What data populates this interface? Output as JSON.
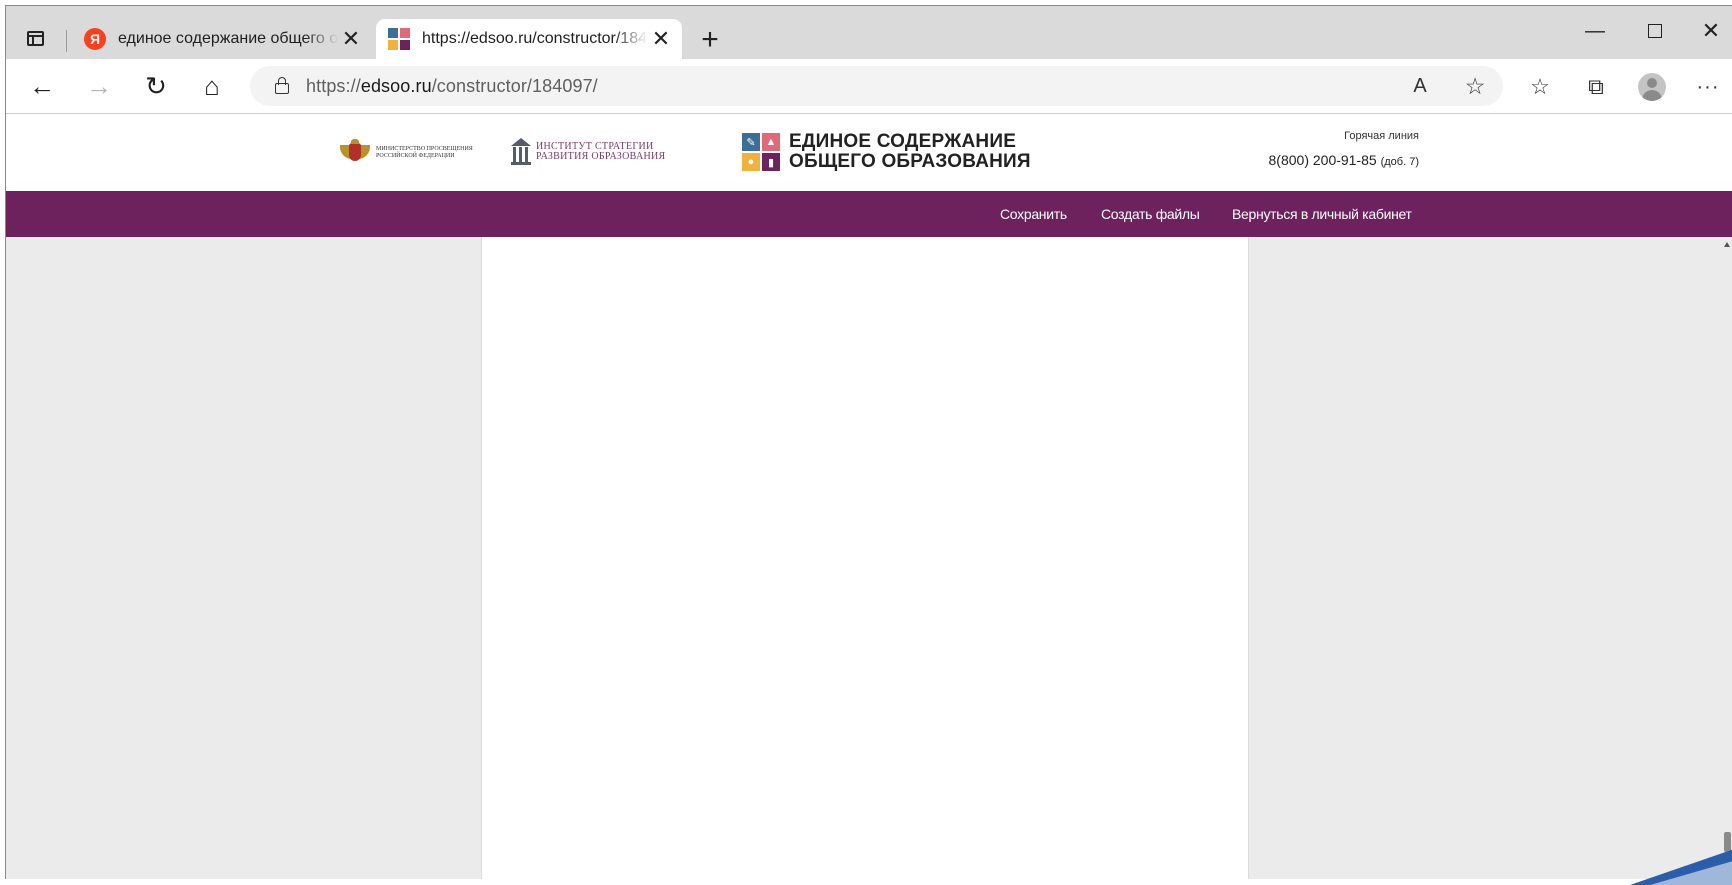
{
  "browser": {
    "tabs": [
      {
        "title": "единое содержание общего об",
        "close": "✕",
        "favicon": "Я",
        "active": false
      },
      {
        "title": "https://edsoo.ru/constructor/184",
        "close": "✕",
        "active": true
      }
    ],
    "new_tab": "+",
    "window_controls": {
      "minimize": "—",
      "close": "✕"
    },
    "address": {
      "scheme": "https://",
      "host": "edsoo.ru",
      "path": "/constructor/184097/"
    },
    "icons": {
      "back": "←",
      "forward": "→",
      "reload": "↻",
      "home": "⌂",
      "read_aloud": "A",
      "add_favorite": "☆",
      "favorites": "☆",
      "collections": "⧉",
      "more": "···"
    }
  },
  "site": {
    "header": {
      "ministry_text": "МИНИСТЕРСТВО ПРОСВЕЩЕНИЯ РОССИЙСКОЙ ФЕДЕРАЦИИ",
      "institute_line1": "ИНСТИТУТ СТРАТЕГИИ",
      "institute_line2": "РАЗВИТИЯ ОБРАЗОВАНИЯ",
      "brand_line1": "ЕДИНОЕ СОДЕРЖАНИЕ",
      "brand_line2": "ОБЩЕГО ОБРАЗОВАНИЯ",
      "hotline_label": "Горячая линия",
      "hotline_phone": "8(800) 200-91-85",
      "hotline_ext": "(доб. 7)"
    },
    "nav": {
      "save": "Сохранить",
      "create_files": "Создать файлы",
      "back_to_cabinet": "Вернуться в личный кабинет"
    }
  },
  "colors": {
    "nav_bg": "#6d215d",
    "tab_strip": "#dadada",
    "page_bg": "#ebebeb",
    "yandex": "#fc3f1d",
    "logo_tiles": [
      "#3d6e96",
      "#e06a7a",
      "#f0b23a",
      "#6d215d"
    ]
  }
}
